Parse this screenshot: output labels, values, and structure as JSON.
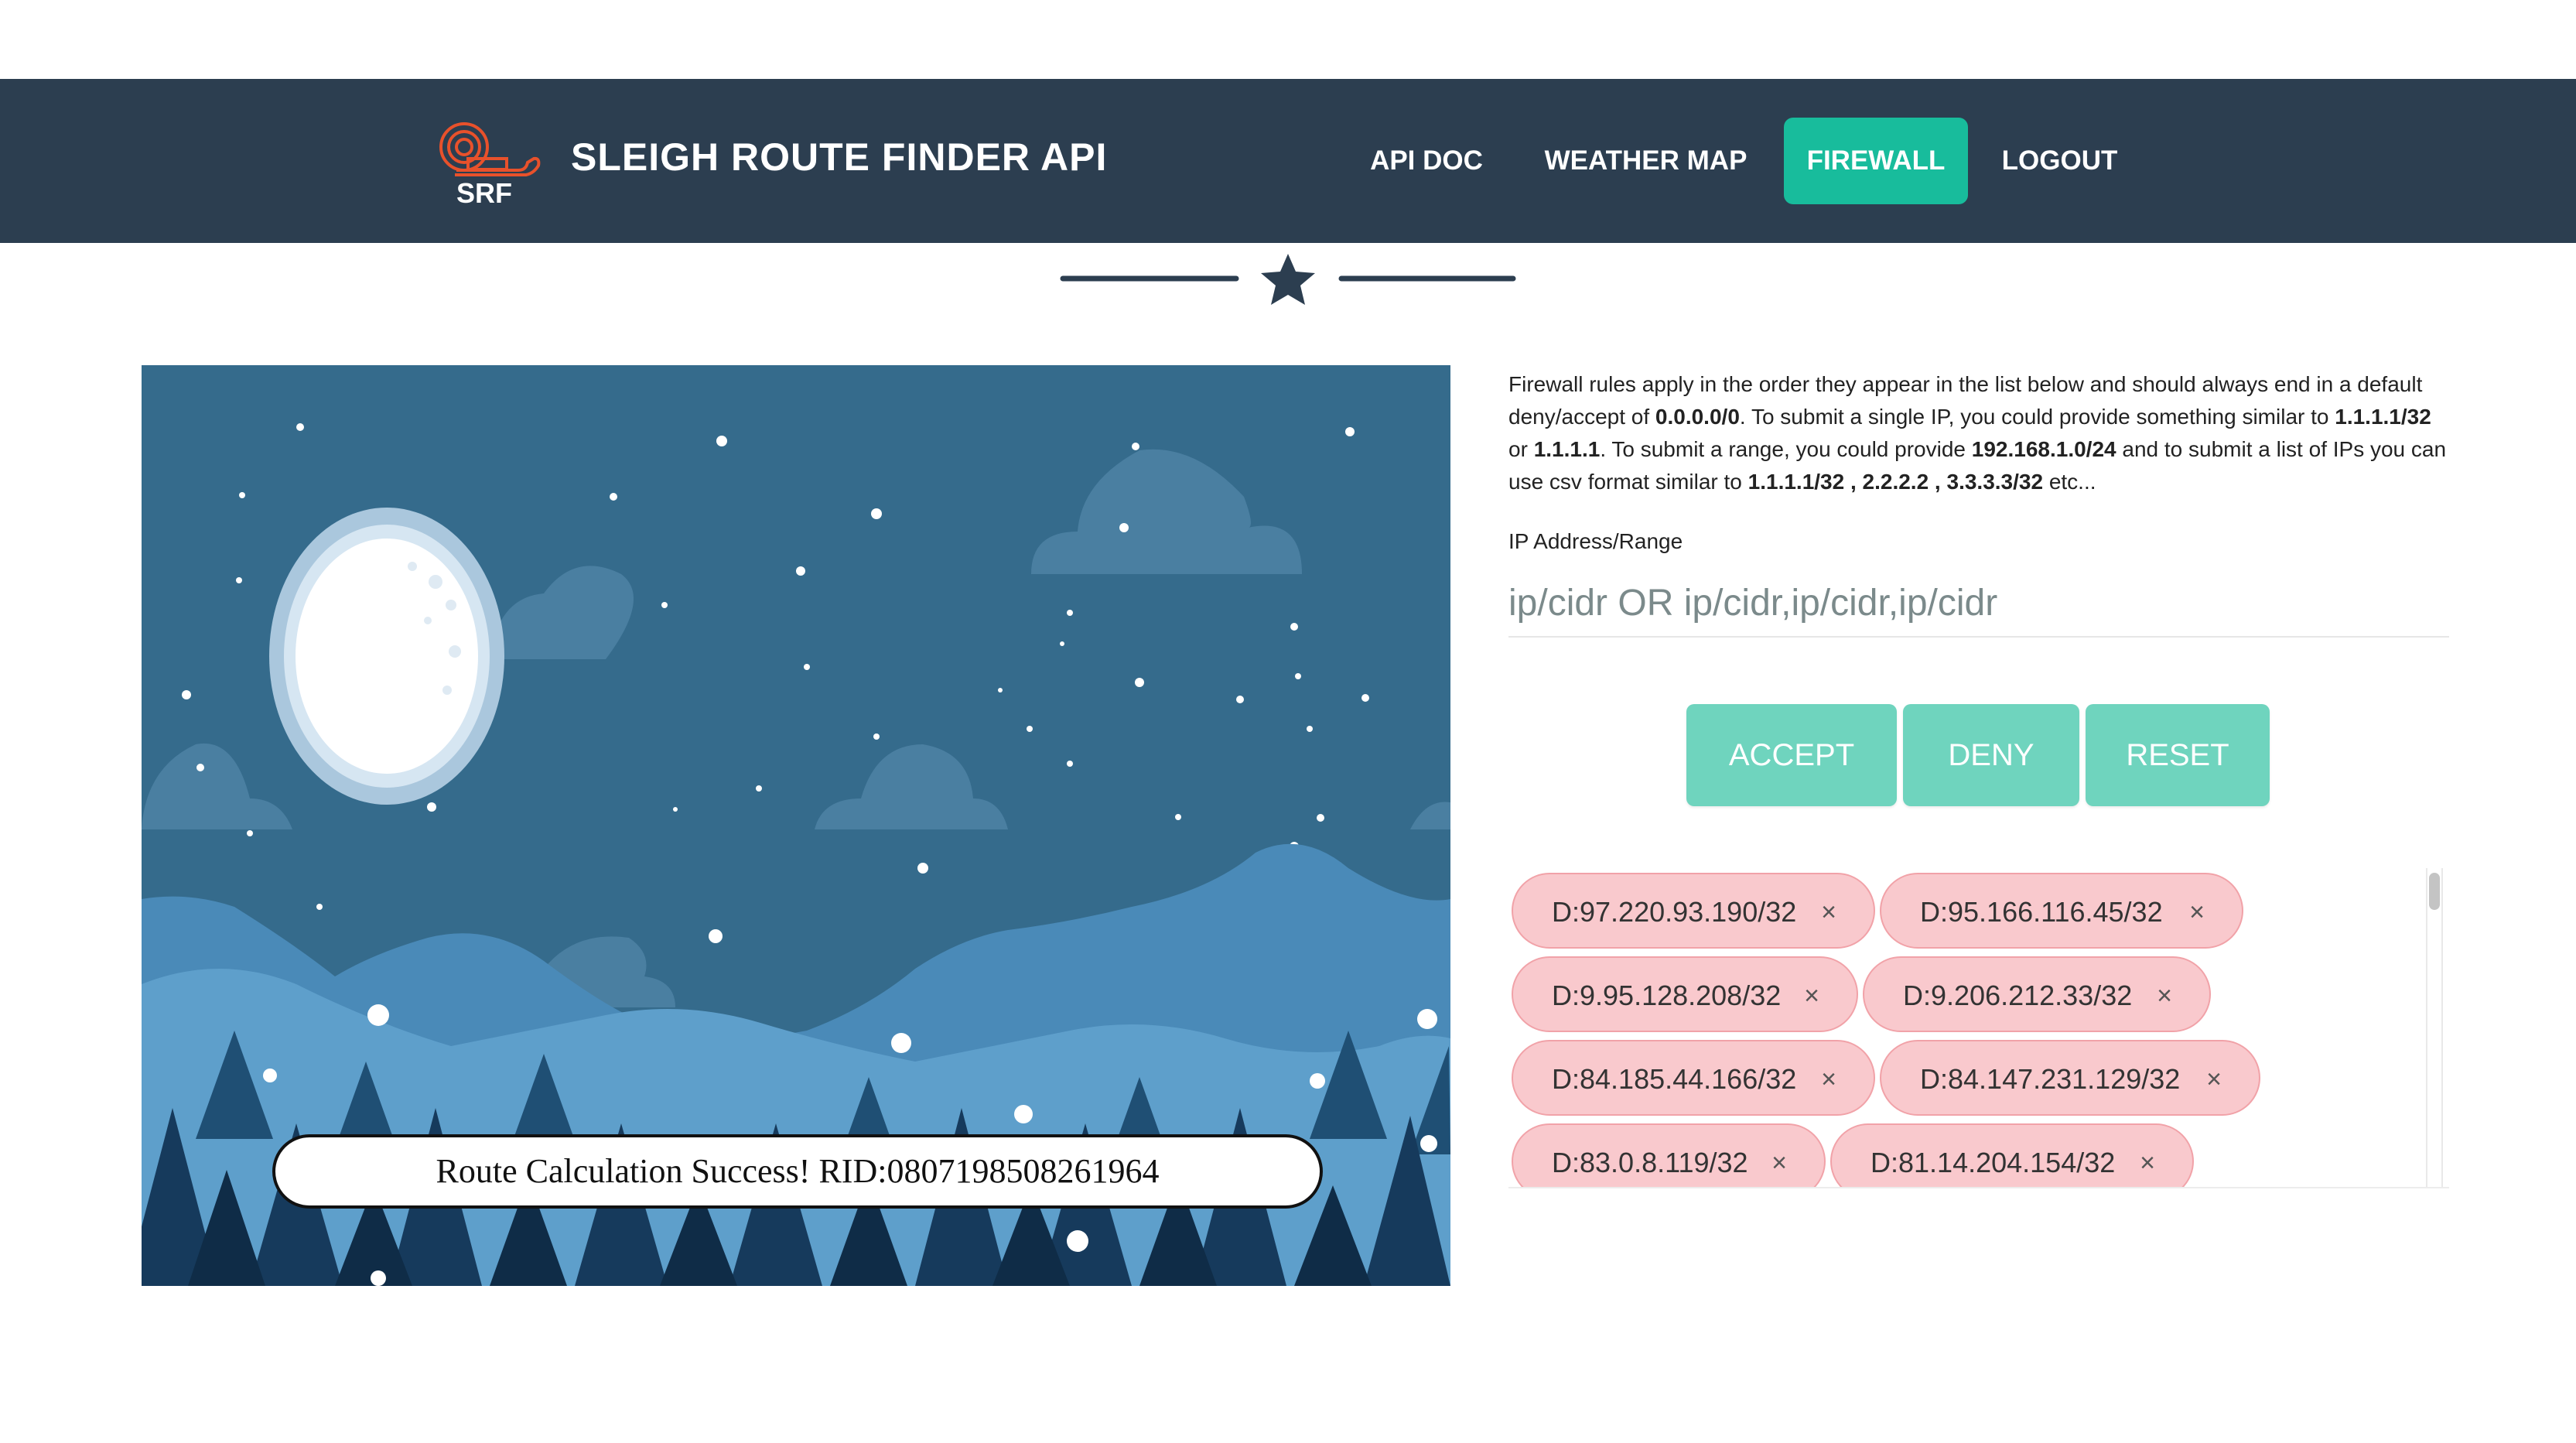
{
  "navbar": {
    "brand": "SLEIGH ROUTE FINDER API",
    "logo_text": "SRF",
    "items": [
      {
        "label": "API DOC",
        "active": false
      },
      {
        "label": "WEATHER MAP",
        "active": false
      },
      {
        "label": "FIREWALL",
        "active": true
      },
      {
        "label": "LOGOUT",
        "active": false
      }
    ]
  },
  "divider": {
    "icon": "star-icon"
  },
  "scene": {
    "description_icon": "night-snow-scene",
    "banner_text": "Route Calculation Success! RID:0807198508261964"
  },
  "firewall": {
    "info_parts": [
      {
        "text": "Firewall rules apply in the order they appear in the list below and should always end in a default deny/accept of ",
        "bold": false
      },
      {
        "text": "0.0.0.0/0",
        "bold": true
      },
      {
        "text": ". To submit a single IP, you could provide something similar to ",
        "bold": false
      },
      {
        "text": "1.1.1.1/32",
        "bold": true
      },
      {
        "text": " or ",
        "bold": false
      },
      {
        "text": "1.1.1.1",
        "bold": true
      },
      {
        "text": ". To submit a range, you could provide ",
        "bold": false
      },
      {
        "text": "192.168.1.0/24",
        "bold": true
      },
      {
        "text": " and to submit a list of IPs you can use csv format similar to ",
        "bold": false
      },
      {
        "text": "1.1.1.1/32 , 2.2.2.2 , 3.3.3.3/32",
        "bold": true
      },
      {
        "text": " etc...",
        "bold": false
      }
    ],
    "field_label": "IP Address/Range",
    "placeholder": "ip/cidr OR ip/cidr,ip/cidr,ip/cidr",
    "value": "",
    "buttons": {
      "accept": "ACCEPT",
      "deny": "DENY",
      "reset": "RESET"
    },
    "rules": [
      "D:97.220.93.190/32",
      "D:95.166.116.45/32",
      "D:9.95.128.208/32",
      "D:9.206.212.33/32",
      "D:84.185.44.166/32",
      "D:84.147.231.129/32",
      "D:83.0.8.119/32",
      "D:81.14.204.154/32"
    ],
    "remove_symbol": "×"
  },
  "colors": {
    "navbar": "#2c3e50",
    "active_nav": "#18bc9c",
    "button": "#6fd4be",
    "deny_tag": "#f9c9cd",
    "deny_tag_border": "#f1a2a8"
  }
}
